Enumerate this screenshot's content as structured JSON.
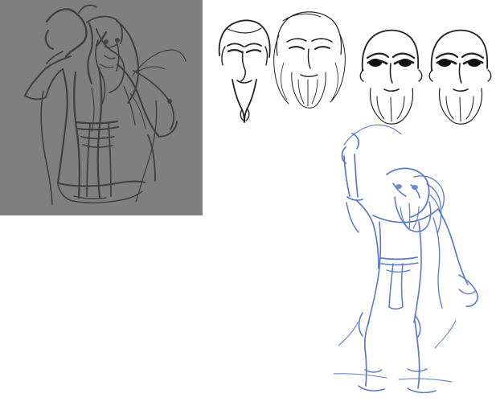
{
  "artwork": {
    "gray_panel_bg": "#7f7f7f",
    "gray_ink": "#3f3f3f",
    "head_ink": "#222222",
    "blue_ink": "#5a79c8",
    "canvas_bg": "#ffffff"
  }
}
